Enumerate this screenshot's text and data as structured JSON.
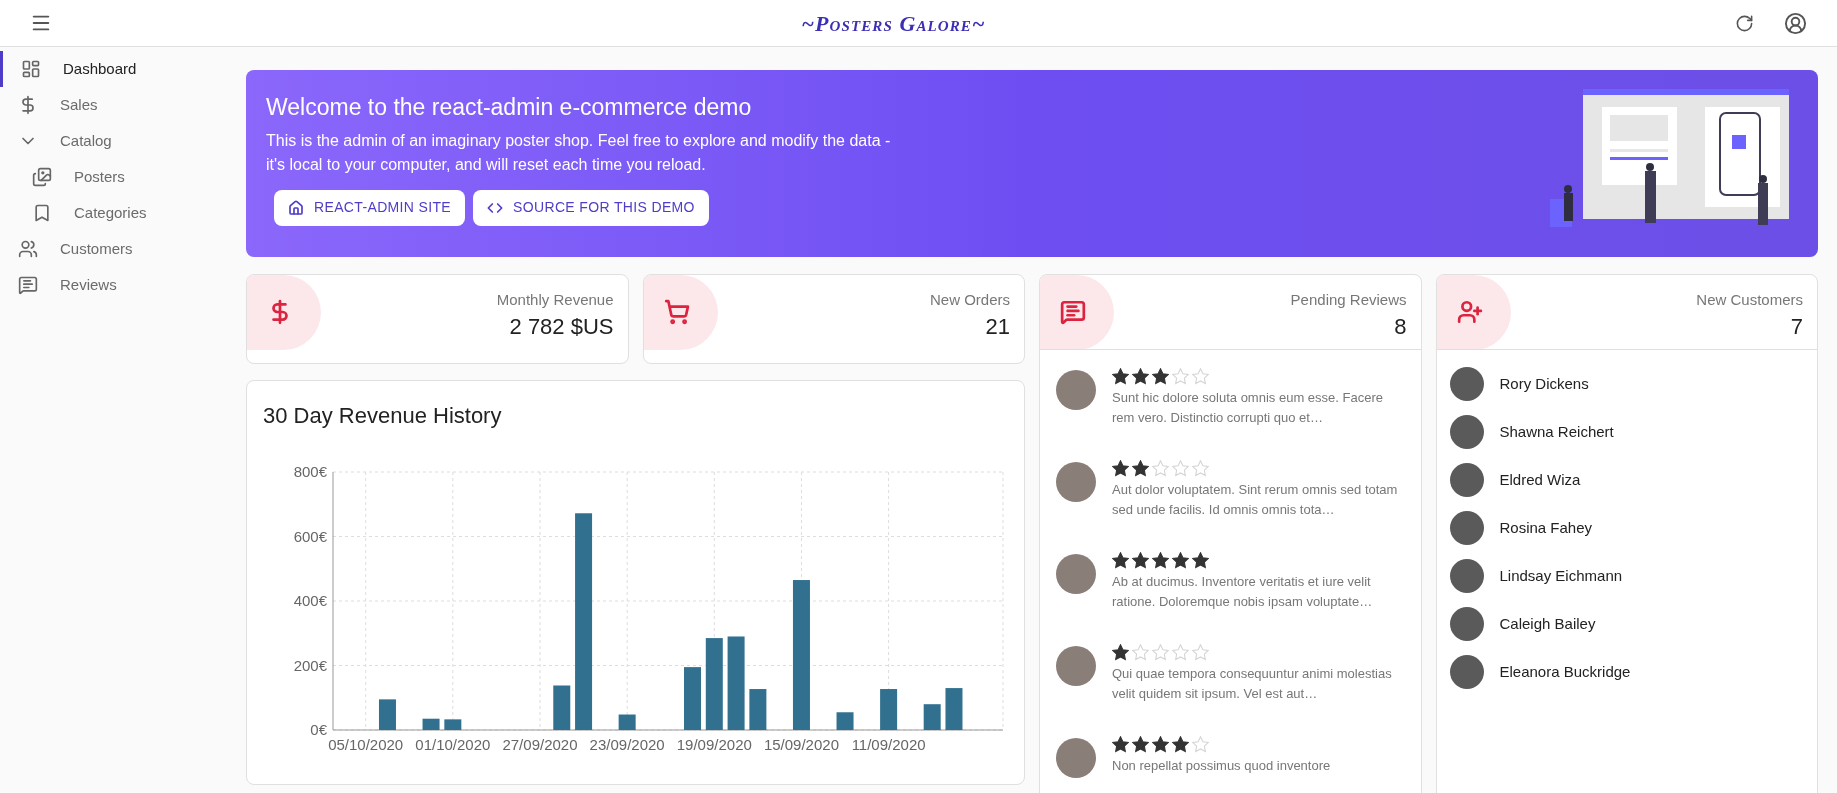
{
  "app_bar": {
    "title": "~Posters Galore~"
  },
  "sidebar": {
    "items": [
      {
        "label": "Dashboard",
        "kind": "dashboard",
        "selected": true
      },
      {
        "label": "Sales",
        "kind": "dollar",
        "selected": false
      },
      {
        "label": "Catalog",
        "kind": "group",
        "selected": false,
        "expanded": true,
        "children": [
          {
            "label": "Posters",
            "kind": "images",
            "selected": false
          },
          {
            "label": "Categories",
            "kind": "bookmark",
            "selected": false
          }
        ]
      },
      {
        "label": "Customers",
        "kind": "people",
        "selected": false
      },
      {
        "label": "Reviews",
        "kind": "comment",
        "selected": false
      }
    ]
  },
  "banner": {
    "title": "Welcome to the react-admin e-commerce demo",
    "text": "This is the admin of an imaginary poster shop. Feel free to explore and modify the data - it's local to your computer, and will reset each time you reload.",
    "buttons": [
      {
        "label": "REACT-ADMIN SITE",
        "kind": "home"
      },
      {
        "label": "SOURCE FOR THIS DEMO",
        "kind": "code"
      }
    ]
  },
  "stats": [
    {
      "label": "Monthly Revenue",
      "value": "2 782 $US",
      "kind": "dollar"
    },
    {
      "label": "New Orders",
      "value": "21",
      "kind": "cart"
    }
  ],
  "revenue_card": {
    "title": "30 Day Revenue History",
    "chart_data": {
      "type": "bar",
      "grid": true,
      "categories": [
        "05/10/2020",
        null,
        null,
        null,
        "01/10/2020",
        null,
        null,
        null,
        "27/09/2020",
        null,
        null,
        null,
        "23/09/2020",
        null,
        null,
        null,
        "19/09/2020",
        null,
        null,
        null,
        "15/09/2020",
        null,
        null,
        null,
        "11/09/2020",
        null,
        null,
        null,
        null,
        null
      ],
      "series": [
        {
          "color": "#31708f",
          "values": [
            0,
            95,
            0,
            35,
            33,
            0,
            0,
            0,
            0,
            138,
            672,
            0,
            48,
            0,
            0,
            195,
            285,
            290,
            127,
            0,
            465,
            0,
            55,
            0,
            127,
            0,
            80,
            130,
            0,
            0
          ]
        }
      ],
      "ylim": [
        0,
        800
      ],
      "yticks": [
        {
          "value": 0,
          "label": "0€"
        },
        {
          "value": 200,
          "label": "200€"
        },
        {
          "value": 400,
          "label": "400€"
        },
        {
          "value": 600,
          "label": "600€"
        },
        {
          "value": 800,
          "label": "800€"
        }
      ]
    }
  },
  "reviews": {
    "label": "Pending Reviews",
    "value": "8",
    "items": [
      {
        "stars": 3,
        "text": "Sunt hic dolore soluta omnis eum esse. Facere rem vero. Distinctio corrupti quo et…"
      },
      {
        "stars": 2,
        "text": "Aut dolor voluptatem. Sint rerum omnis sed totam sed unde facilis. Id omnis omnis tota…"
      },
      {
        "stars": 5,
        "text": "Ab at ducimus. Inventore veritatis et iure velit ratione. Doloremque nobis ipsam voluptate…"
      },
      {
        "stars": 1,
        "text": "Qui quae tempora consequuntur animi molestias velit quidem sit ipsum. Vel est aut…"
      },
      {
        "stars": 4,
        "text": "Non repellat possimus quod inventore"
      }
    ]
  },
  "customers": {
    "label": "New Customers",
    "value": "7",
    "items": [
      {
        "name": "Rory Dickens"
      },
      {
        "name": "Shawna Reichert"
      },
      {
        "name": "Eldred Wiza"
      },
      {
        "name": "Rosina Fahey"
      },
      {
        "name": "Lindsay Eichmann"
      },
      {
        "name": "Caleigh Bailey"
      },
      {
        "name": "Eleanora Buckridge"
      }
    ]
  }
}
